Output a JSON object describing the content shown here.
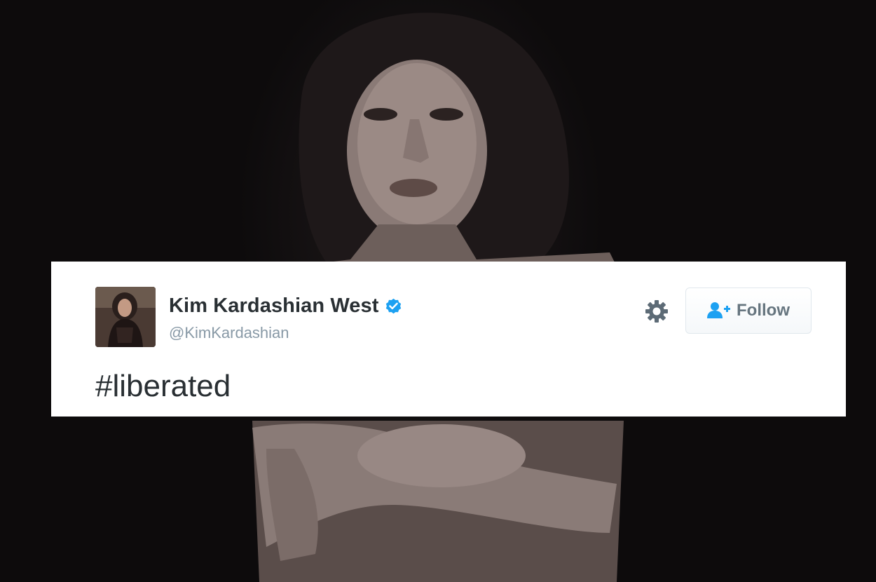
{
  "tweet": {
    "display_name": "Kim Kardashian West",
    "username": "@KimKardashian",
    "text": "#liberated",
    "verified": true
  },
  "actions": {
    "follow_label": "Follow"
  },
  "icons": {
    "verified": "verified-badge-icon",
    "settings": "gear-icon",
    "follow": "add-user-icon"
  },
  "colors": {
    "verified_blue": "#1da1f2",
    "name_text": "#292f33",
    "handle_text": "#8899a6",
    "follow_text": "#66757f",
    "follow_icon": "#1da1f2",
    "card_background": "#ffffff"
  }
}
